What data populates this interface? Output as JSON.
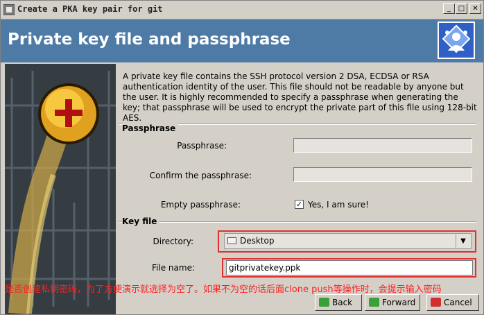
{
  "window": {
    "title": "Create a PKA key pair for git"
  },
  "window_controls": {
    "minimize": "_",
    "maximize": "□",
    "close": "✕"
  },
  "header": {
    "title": "Private key file and passphrase"
  },
  "intro": "A private key file contains the SSH protocol version 2 DSA, ECDSA or RSA authentication identity of the user. This file should not be readable by anyone but the user. It is highly recommended to specify a passphrase when generating the key; that passphrase will be used to encrypt the private part of this file using 128-bit AES.",
  "passphrase_section": {
    "title": "Passphrase",
    "passphrase_label": "Passphrase:",
    "passphrase_value": "",
    "confirm_label": "Confirm the passphrase:",
    "confirm_value": "",
    "empty_label": "Empty passphrase:",
    "empty_checked": true,
    "empty_check_label": "Yes, I am sure!"
  },
  "keyfile_section": {
    "title": "Key file",
    "directory_label": "Directory:",
    "directory_value": "Desktop",
    "filename_label": "File name:",
    "filename_value": "gitprivatekey.ppk"
  },
  "annotation": "是否创建私钥密码，为了方便演示就选择为空了。如果不为空的话后面clone push等操作时，会提示输入密码",
  "buttons": {
    "back": "Back",
    "forward": "Forward",
    "cancel": "Cancel"
  },
  "colors": {
    "header_bg": "#4e7aa6",
    "highlight": "#e03030",
    "annotation": "#ff2020"
  }
}
